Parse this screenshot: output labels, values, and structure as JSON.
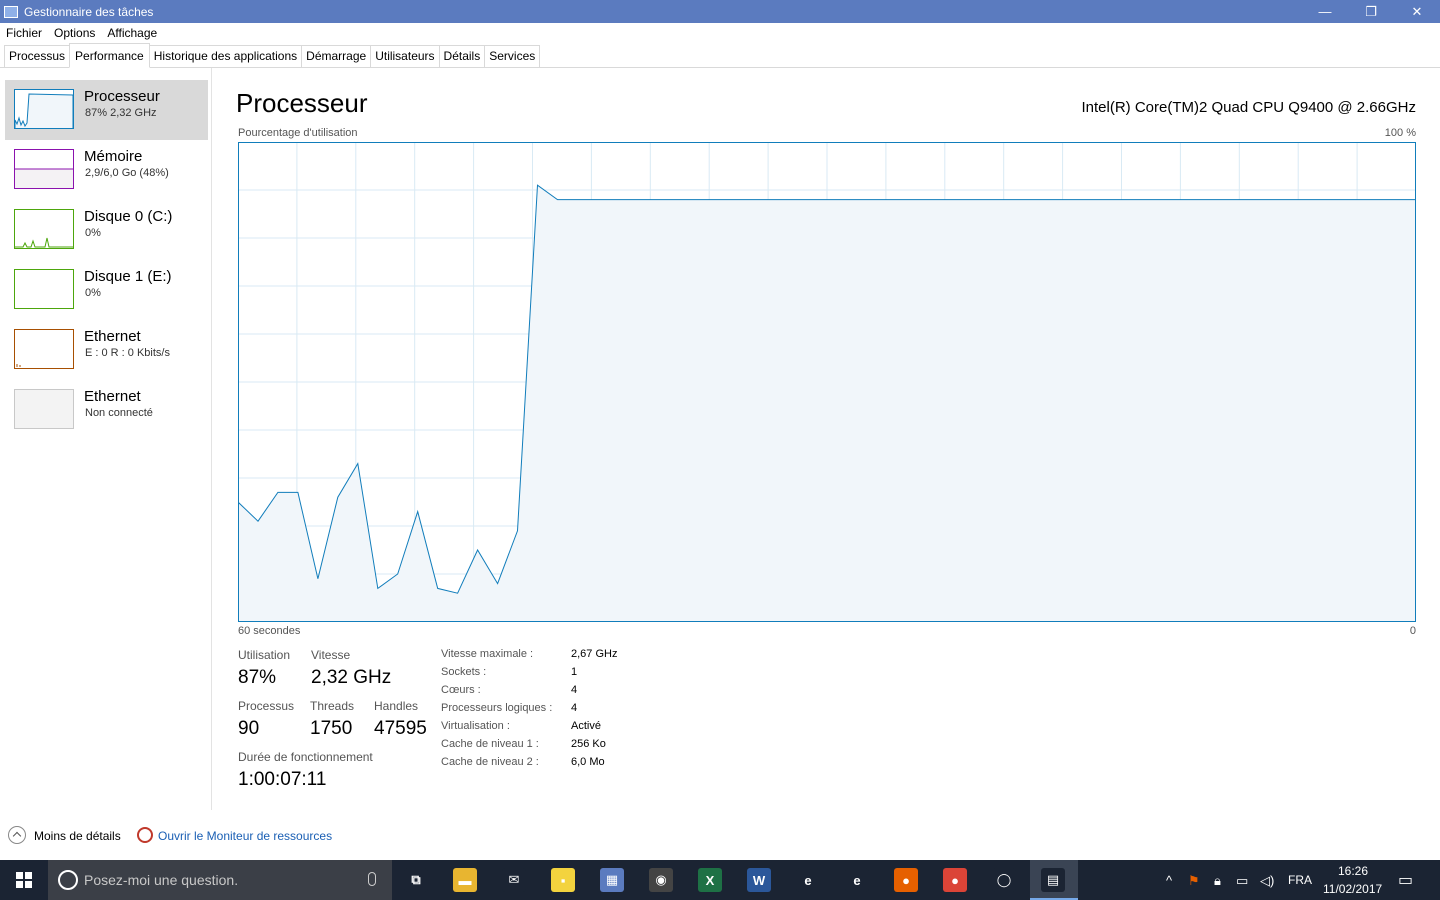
{
  "window": {
    "title": "Gestionnaire des tâches",
    "buttons": [
      "—",
      "❐",
      "✕"
    ]
  },
  "menu": [
    "Fichier",
    "Options",
    "Affichage"
  ],
  "tabs": [
    "Processus",
    "Performance",
    "Historique des applications",
    "Démarrage",
    "Utilisateurs",
    "Détails",
    "Services"
  ],
  "active_tab": "Performance",
  "sidebar": [
    {
      "name": "Processeur",
      "sub": "87% 2,32 GHz",
      "color": "#117dbb",
      "active": true
    },
    {
      "name": "Mémoire",
      "sub": "2,9/6,0 Go (48%)",
      "color": "#8b12ae",
      "active": false
    },
    {
      "name": "Disque 0 (C:)",
      "sub": "0%",
      "color": "#4da60c",
      "active": false
    },
    {
      "name": "Disque 1 (E:)",
      "sub": "0%",
      "color": "#4da60c",
      "active": false
    },
    {
      "name": "Ethernet",
      "sub": "E : 0 R : 0 Kbits/s",
      "color": "#a74f01",
      "active": false
    },
    {
      "name": "Ethernet",
      "sub": "Non connecté",
      "color": "#c0c0c0",
      "active": false
    }
  ],
  "main": {
    "title": "Processeur",
    "cpu_name": "Intel(R) Core(TM)2 Quad CPU Q9400 @ 2.66GHz",
    "graph_label": "Pourcentage d'utilisation",
    "graph_max": "100 %",
    "graph_time": "60 secondes",
    "graph_min": "0",
    "line_color": "#117dbb",
    "fill_color": "#f1f6fa",
    "grid_color": "#d9eaf4"
  },
  "cpu_usage_history": [
    25,
    21,
    27,
    27,
    9,
    26,
    33,
    7,
    10,
    23,
    7,
    6,
    15,
    8,
    19,
    91,
    88,
    88,
    88,
    88,
    88,
    88,
    88,
    88,
    88,
    88,
    88,
    88,
    88,
    88,
    88,
    88,
    88,
    88,
    88,
    88,
    88,
    88,
    88,
    88,
    88,
    88,
    88,
    88,
    88,
    88,
    88,
    88,
    88,
    88,
    88,
    88,
    88,
    88,
    88,
    88,
    88,
    88,
    88,
    88
  ],
  "stats": {
    "utilisation_label": "Utilisation",
    "utilisation": "87%",
    "vitesse_label": "Vitesse",
    "vitesse": "2,32 GHz",
    "processus_label": "Processus",
    "processus": "90",
    "threads_label": "Threads",
    "threads": "1750",
    "handles_label": "Handles",
    "handles": "47595",
    "uptime_label": "Durée de fonctionnement",
    "uptime": "1:00:07:11"
  },
  "specs": [
    {
      "label": "Vitesse maximale :",
      "value": "2,67 GHz"
    },
    {
      "label": "Sockets :",
      "value": "1"
    },
    {
      "label": "Cœurs :",
      "value": "4"
    },
    {
      "label": "Processeurs logiques :",
      "value": "4"
    },
    {
      "label": "Virtualisation :",
      "value": "Activé"
    },
    {
      "label": "Cache de niveau 1 :",
      "value": "256 Ko"
    },
    {
      "label": "Cache de niveau 2 :",
      "value": "6,0 Mo"
    }
  ],
  "footer": {
    "fewer_details": "Moins de détails",
    "resource_monitor": "Ouvrir le Moniteur de ressources"
  },
  "taskbar": {
    "search_placeholder": "Posez-moi une question.",
    "lang": "FRA",
    "time": "16:26",
    "date": "11/02/2017",
    "apps": [
      {
        "name": "task-view",
        "glyph": "⧉",
        "color": "#1b2433"
      },
      {
        "name": "file-explorer",
        "glyph": "▬",
        "color": "#e8b530"
      },
      {
        "name": "mail",
        "glyph": "✉",
        "color": "#1b2433"
      },
      {
        "name": "sticky-notes",
        "glyph": "▪",
        "color": "#f3d33e"
      },
      {
        "name": "network-app",
        "glyph": "▦",
        "color": "#5b7bbf"
      },
      {
        "name": "media-app",
        "glyph": "◉",
        "color": "#444444"
      },
      {
        "name": "excel",
        "glyph": "X",
        "color": "#1e7145"
      },
      {
        "name": "word",
        "glyph": "W",
        "color": "#2b579a"
      },
      {
        "name": "edge",
        "glyph": "e",
        "color": "#1b2433"
      },
      {
        "name": "internet-explorer",
        "glyph": "e",
        "color": "#1b2433"
      },
      {
        "name": "firefox",
        "glyph": "●",
        "color": "#e66000"
      },
      {
        "name": "chrome",
        "glyph": "●",
        "color": "#db4437"
      },
      {
        "name": "green-app",
        "glyph": "◯",
        "color": "#1b2433"
      },
      {
        "name": "task-manager",
        "glyph": "▤",
        "color": "#1b2433"
      }
    ]
  }
}
